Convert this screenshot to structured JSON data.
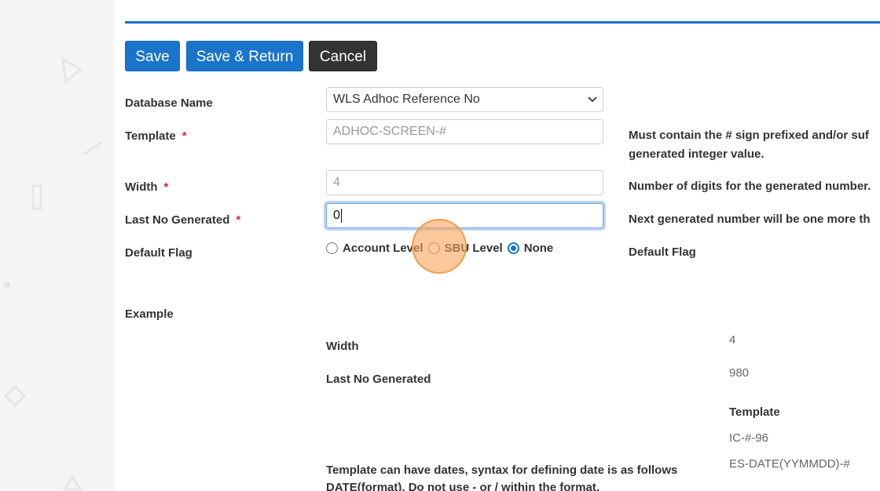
{
  "toolbar": {
    "save_label": "Save",
    "save_return_label": "Save & Return",
    "cancel_label": "Cancel"
  },
  "form": {
    "database_name": {
      "label": "Database Name",
      "value": "WLS Adhoc Reference No"
    },
    "template": {
      "label": "Template",
      "required": "*",
      "placeholder": "ADHOC-SCREEN-#",
      "help_line1": "Must contain the # sign prefixed and/or suf",
      "help_line2": "generated integer value."
    },
    "width": {
      "label": "Width",
      "required": "*",
      "placeholder": "4",
      "help": "Number of digits for the generated number."
    },
    "last_no_generated": {
      "label": "Last No Generated",
      "required": "*",
      "value": "0",
      "help": "Next generated number will be one more th"
    },
    "default_flag": {
      "label": "Default Flag",
      "options": [
        "Account Level",
        "SBU Level",
        "None"
      ],
      "selected": "None",
      "help": "Default Flag"
    }
  },
  "example": {
    "heading": "Example",
    "width_label": "Width",
    "width_value": "4",
    "last_no_label": "Last No Generated",
    "last_no_value": "980",
    "template_label": "Template",
    "template_value1": "IC-#-96",
    "template_value2": "ES-DATE(YYMMDD)-#",
    "note_line1": "Template can have dates, syntax for defining date is as follows",
    "note_line2": "DATE(format). Do not use - or / within the format."
  },
  "colors": {
    "accent": "#1a74cc",
    "dark_button": "#333333",
    "required": "#d9262c",
    "cursor_highlight": "#f7a456"
  },
  "icons": {
    "select": "chevron-down-icon"
  }
}
